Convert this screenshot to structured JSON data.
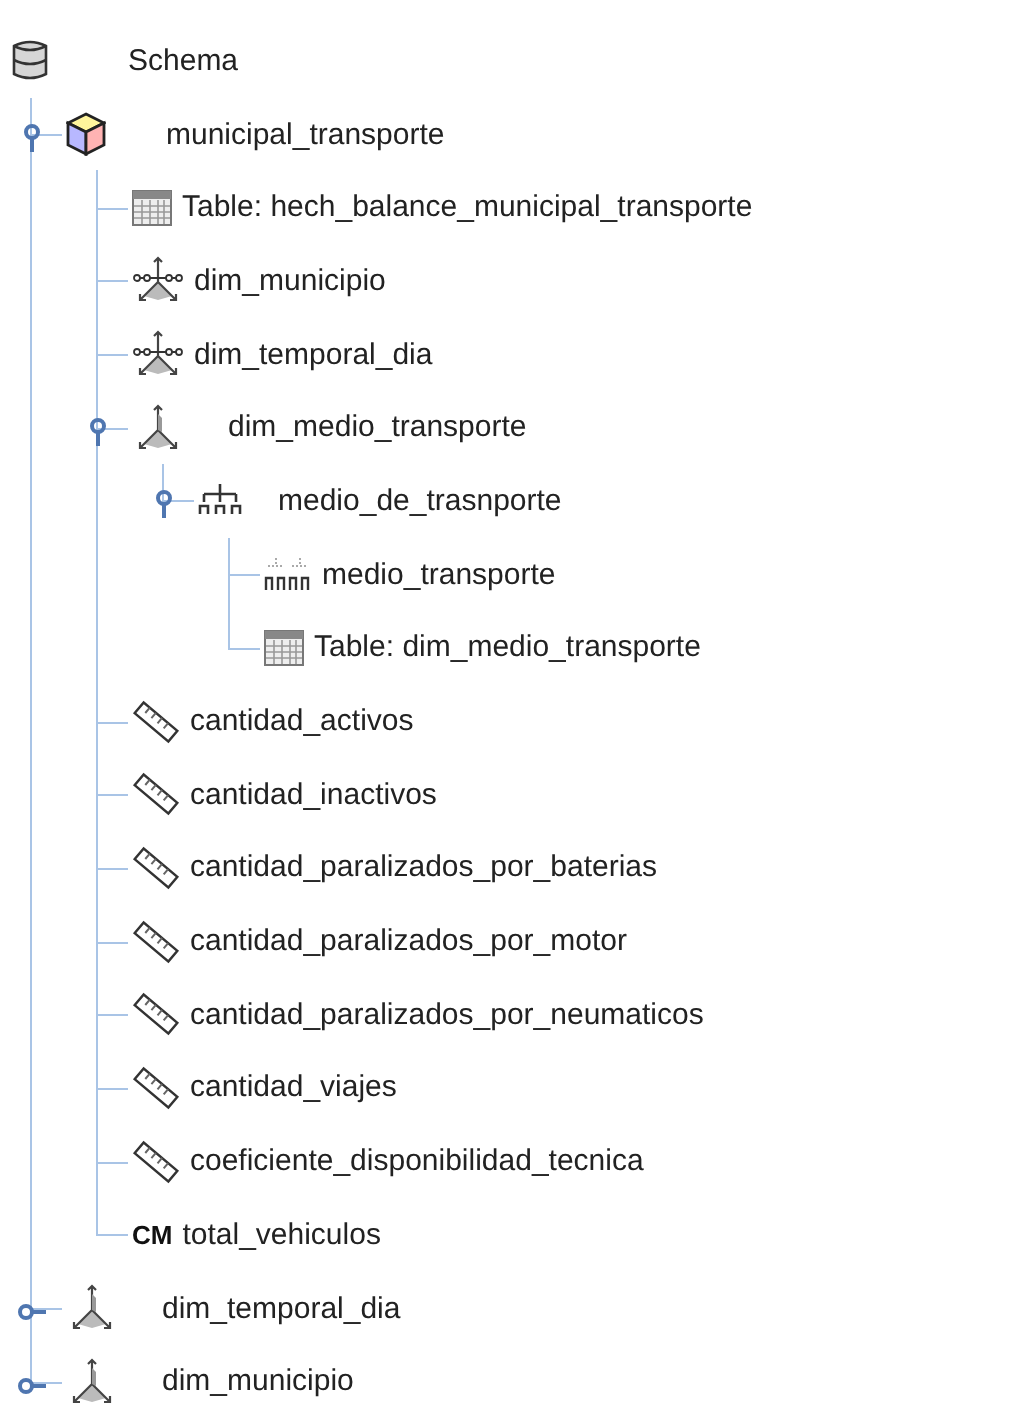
{
  "tree": [
    {
      "kind": "schema",
      "label": "Schema",
      "children": [
        {
          "kind": "cube",
          "label": "municipal_transporte",
          "expanded": true,
          "children": [
            {
              "kind": "table",
              "label": "Table: hech_balance_municipal_transporte"
            },
            {
              "kind": "dimension_usage",
              "label": "dim_municipio"
            },
            {
              "kind": "dimension_usage",
              "label": "dim_temporal_dia"
            },
            {
              "kind": "dimension",
              "label": "dim_medio_transporte",
              "expanded": true,
              "children": [
                {
                  "kind": "hierarchy",
                  "label": "medio_de_trasnporte",
                  "expanded": true,
                  "children": [
                    {
                      "kind": "level",
                      "label": "medio_transporte"
                    },
                    {
                      "kind": "table",
                      "label": "Table: dim_medio_transporte"
                    }
                  ]
                }
              ]
            },
            {
              "kind": "measure",
              "label": "cantidad_activos"
            },
            {
              "kind": "measure",
              "label": "cantidad_inactivos"
            },
            {
              "kind": "measure",
              "label": "cantidad_paralizados_por_baterias"
            },
            {
              "kind": "measure",
              "label": "cantidad_paralizados_por_motor"
            },
            {
              "kind": "measure",
              "label": "cantidad_paralizados_por_neumaticos"
            },
            {
              "kind": "measure",
              "label": "cantidad_viajes"
            },
            {
              "kind": "measure",
              "label": "coeficiente_disponibilidad_tecnica"
            },
            {
              "kind": "calculated_member",
              "badge": "CM",
              "label": "total_vehiculos"
            }
          ]
        },
        {
          "kind": "dimension",
          "label": "dim_temporal_dia",
          "expanded": false
        },
        {
          "kind": "dimension",
          "label": "dim_municipio",
          "expanded": false
        }
      ]
    }
  ]
}
